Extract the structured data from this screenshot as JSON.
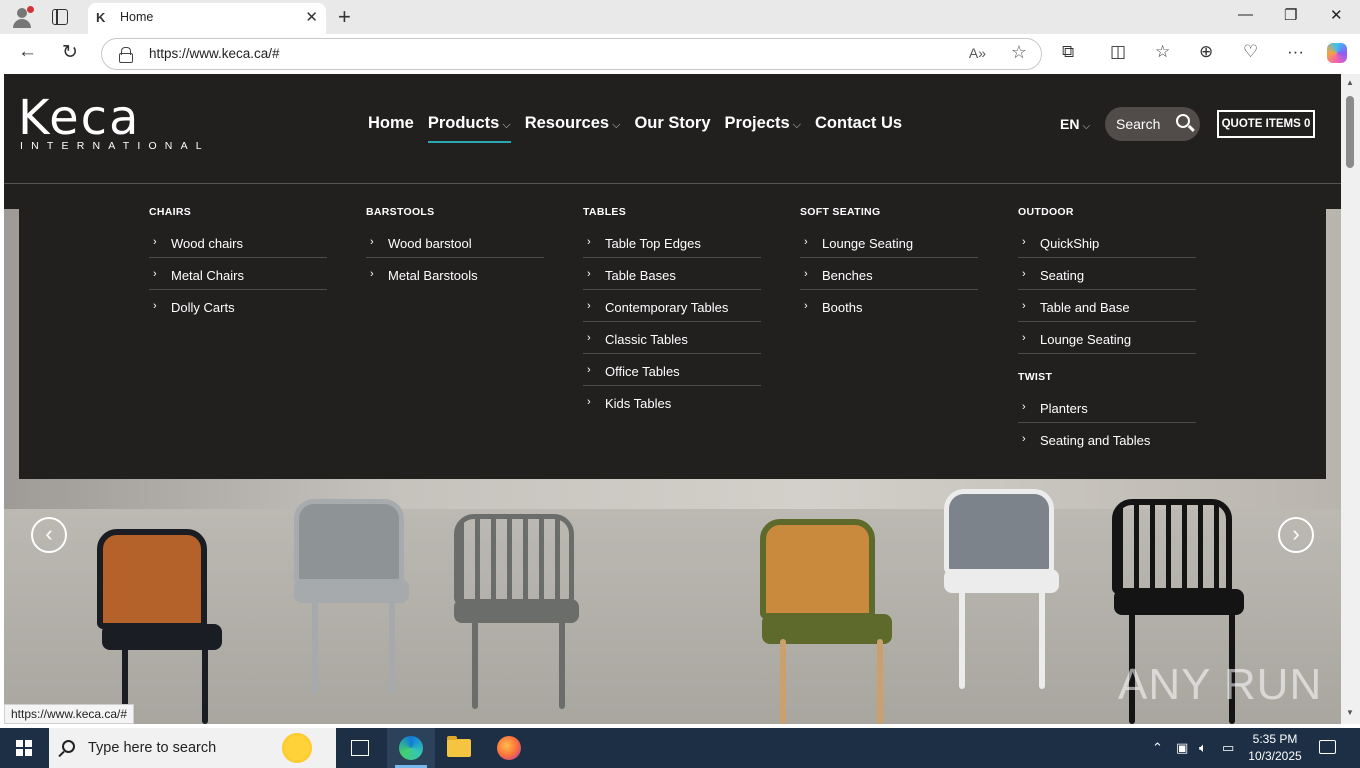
{
  "browser": {
    "tab_title": "Home",
    "tab_favicon": "K",
    "url": "https://www.keca.ca/#",
    "status_url": "https://www.keca.ca/#"
  },
  "site": {
    "logo_word": "Keca",
    "logo_sub": "INTERNATIONAL",
    "nav": [
      {
        "label": "Home",
        "has_menu": false,
        "active": false
      },
      {
        "label": "Products",
        "has_menu": true,
        "active": true
      },
      {
        "label": "Resources",
        "has_menu": true,
        "active": false
      },
      {
        "label": "Our Story",
        "has_menu": false,
        "active": false
      },
      {
        "label": "Projects",
        "has_menu": true,
        "active": false
      },
      {
        "label": "Contact Us",
        "has_menu": false,
        "active": false
      }
    ],
    "lang": "EN",
    "search_label": "Search",
    "quote_label": "QUOTE ITEMS 0"
  },
  "mega_menu": {
    "columns": [
      {
        "heading": "CHAIRS",
        "links": [
          "Wood chairs",
          "Metal Chairs",
          "Dolly Carts"
        ]
      },
      {
        "heading": "BARSTOOLS",
        "links": [
          "Wood barstool",
          "Metal Barstools"
        ]
      },
      {
        "heading": "TABLES",
        "links": [
          "Table Top Edges",
          "Table Bases",
          "Contemporary Tables",
          "Classic Tables",
          "Office Tables",
          "Kids Tables"
        ]
      },
      {
        "heading": "SOFT SEATING",
        "links": [
          "Lounge Seating",
          "Benches",
          "Booths"
        ]
      },
      {
        "heading": "OUTDOOR",
        "links": [
          "QuickShip",
          "Seating",
          "Table and Base",
          "Lounge Seating"
        ],
        "subheading": "TWIST",
        "sublinks": [
          "Planters",
          "Seating and Tables"
        ]
      }
    ]
  },
  "watermark": "ANY RUN",
  "taskbar": {
    "search_placeholder": "Type here to search",
    "time": "5:35 PM",
    "date": "10/3/2025"
  },
  "colors": {
    "site_bg": "#221f1f",
    "accent": "#2aa6b7",
    "taskbar": "#1c2f45"
  }
}
